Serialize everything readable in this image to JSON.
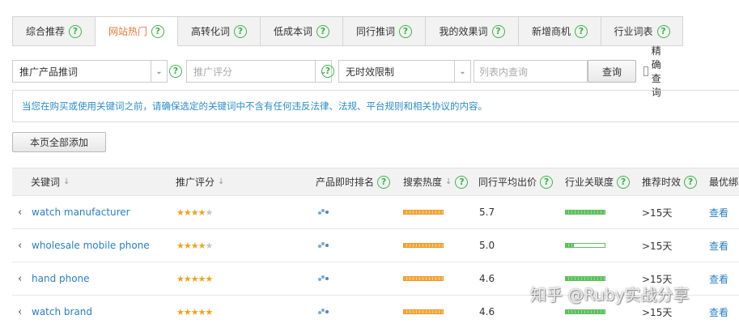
{
  "tabs": [
    {
      "label": "综合推荐",
      "active": false
    },
    {
      "label": "网站热门",
      "active": true
    },
    {
      "label": "高转化词",
      "active": false
    },
    {
      "label": "低成本词",
      "active": false
    },
    {
      "label": "同行推词",
      "active": false
    },
    {
      "label": "我的效果词",
      "active": false
    },
    {
      "label": "新增商机",
      "active": false
    },
    {
      "label": "行业词表",
      "active": false
    }
  ],
  "filters": {
    "product_select": "推广产品推词",
    "score_placeholder": "推广评分",
    "time_select": "无时效限制",
    "search_placeholder": "列表内查询",
    "query_button": "查询",
    "exact_label": "精确查询"
  },
  "notice": "当您在购买或使用关键词之前，请确保选定的关键词中不含有任何违反法律、法规、平台规则和相关协议的内容。",
  "add_all_button": "本页全部添加",
  "table": {
    "headers": {
      "keyword": "关键词",
      "score": "推广评分",
      "rank": "产品即时排名",
      "heat": "搜索热度",
      "avg_bid": "同行平均出价",
      "relevance": "行业关联度",
      "timeliness": "推荐时效",
      "best": "最优绑"
    },
    "rows": [
      {
        "keyword": "watch manufacturer",
        "stars": 4,
        "avg_bid": "5.7",
        "relevance": 1.0,
        "timeliness": ">15天",
        "action": "查看"
      },
      {
        "keyword": "wholesale mobile phone",
        "stars": 4,
        "avg_bid": "5.0",
        "relevance": 0.2,
        "timeliness": ">15天",
        "action": "查看"
      },
      {
        "keyword": "hand phone",
        "stars": 5,
        "avg_bid": "4.6",
        "relevance": 1.0,
        "timeliness": ">15天",
        "action": "查看"
      },
      {
        "keyword": "watch brand",
        "stars": 5,
        "avg_bid": "4.6",
        "relevance": 1.0,
        "timeliness": ">15天",
        "action": "查看"
      }
    ]
  },
  "watermark": "知乎 @Ruby实战分享",
  "colors": {
    "accent_orange": "#e47a38",
    "link_blue": "#2a7fc4",
    "help_green": "#3bb54a",
    "star": "#f0a21c"
  }
}
